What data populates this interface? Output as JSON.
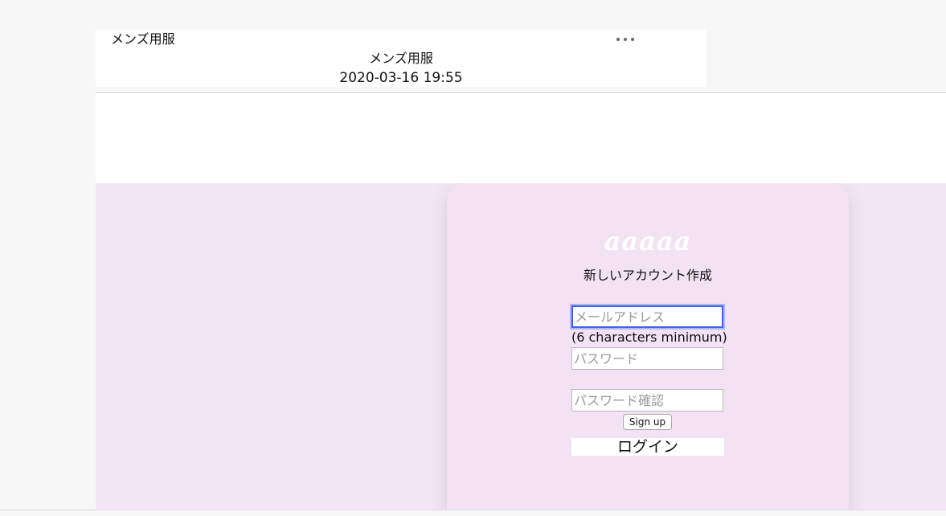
{
  "post": {
    "top_title": "メンズ用服",
    "title": "メンズ用服",
    "date": "2020-03-16 19:55",
    "more_icon": "more-horizontal-icon"
  },
  "signup": {
    "brand": "aaaaa",
    "heading": "新しいアカウント作成",
    "email_placeholder": "メールアドレス",
    "email_value": "",
    "hint": "(6 characters minimum)",
    "password_placeholder": "パスワード",
    "password_value": "",
    "confirm_placeholder": "パスワード確認",
    "confirm_value": "",
    "submit_label": "Sign up",
    "login_label": "ログイン"
  },
  "colors": {
    "page_background": "#f7f7f7",
    "section_background": "#f4e6f6",
    "card_background": "#f2e2f3",
    "focus_ring": "#3d63e8"
  }
}
